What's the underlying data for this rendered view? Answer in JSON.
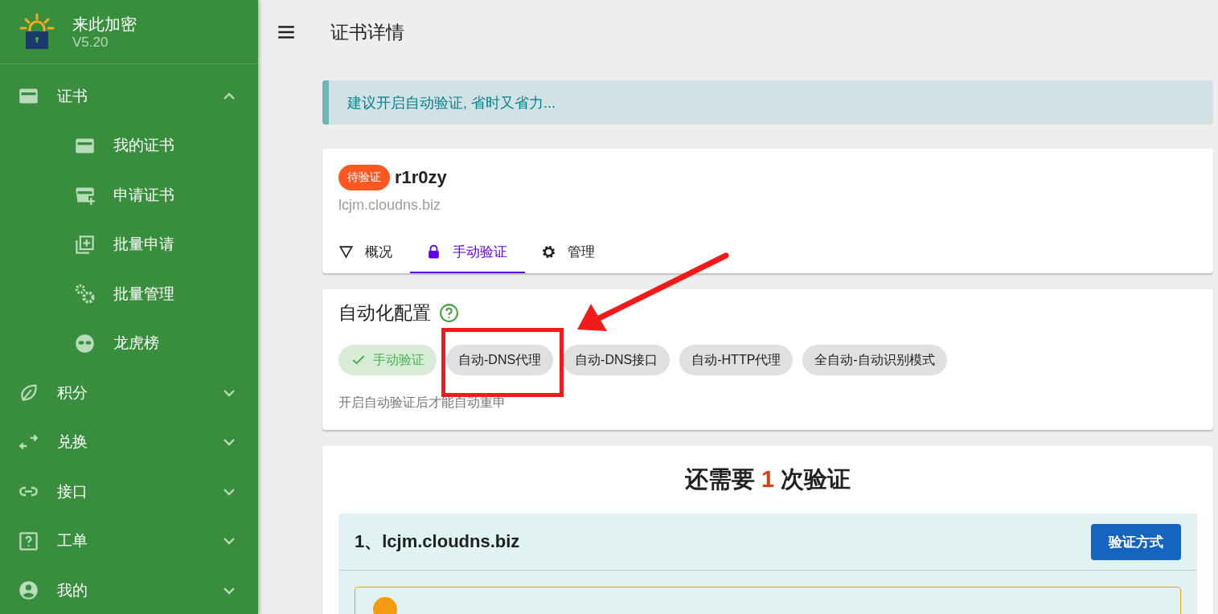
{
  "app": {
    "name": "来此加密",
    "version": "V5.20"
  },
  "sidebar": {
    "items": [
      {
        "label": "证书",
        "expanded": true,
        "children": [
          {
            "label": "我的证书"
          },
          {
            "label": "申请证书"
          },
          {
            "label": "批量申请"
          },
          {
            "label": "批量管理"
          },
          {
            "label": "龙虎榜"
          }
        ]
      },
      {
        "label": "积分",
        "expanded": false
      },
      {
        "label": "兑换",
        "expanded": false
      },
      {
        "label": "接口",
        "expanded": false
      },
      {
        "label": "工单",
        "expanded": false
      },
      {
        "label": "我的",
        "expanded": false
      }
    ]
  },
  "page": {
    "title": "证书详情"
  },
  "notice": "建议开启自动验证, 省时又省力...",
  "certificate": {
    "status": "待验证",
    "name": "r1r0zy",
    "domain": "lcjm.cloudns.biz",
    "tabs": [
      {
        "label": "概况",
        "selected": false
      },
      {
        "label": "手动验证",
        "selected": true
      },
      {
        "label": "管理",
        "selected": false
      }
    ]
  },
  "automation": {
    "title": "自动化配置",
    "modes": [
      {
        "label": "手动验证",
        "selected": true
      },
      {
        "label": "自动-DNS代理",
        "selected": false
      },
      {
        "label": "自动-DNS接口",
        "selected": false
      },
      {
        "label": "自动-HTTP代理",
        "selected": false
      },
      {
        "label": "全自动-自动识别模式",
        "selected": false
      }
    ],
    "note": "开启自动验证后才能自动重申"
  },
  "verification": {
    "heading_before": "还需要",
    "count": "1",
    "heading_after": "次验证",
    "domains": [
      {
        "title": "1、lcjm.cloudns.biz",
        "button": "验证方式"
      }
    ]
  }
}
